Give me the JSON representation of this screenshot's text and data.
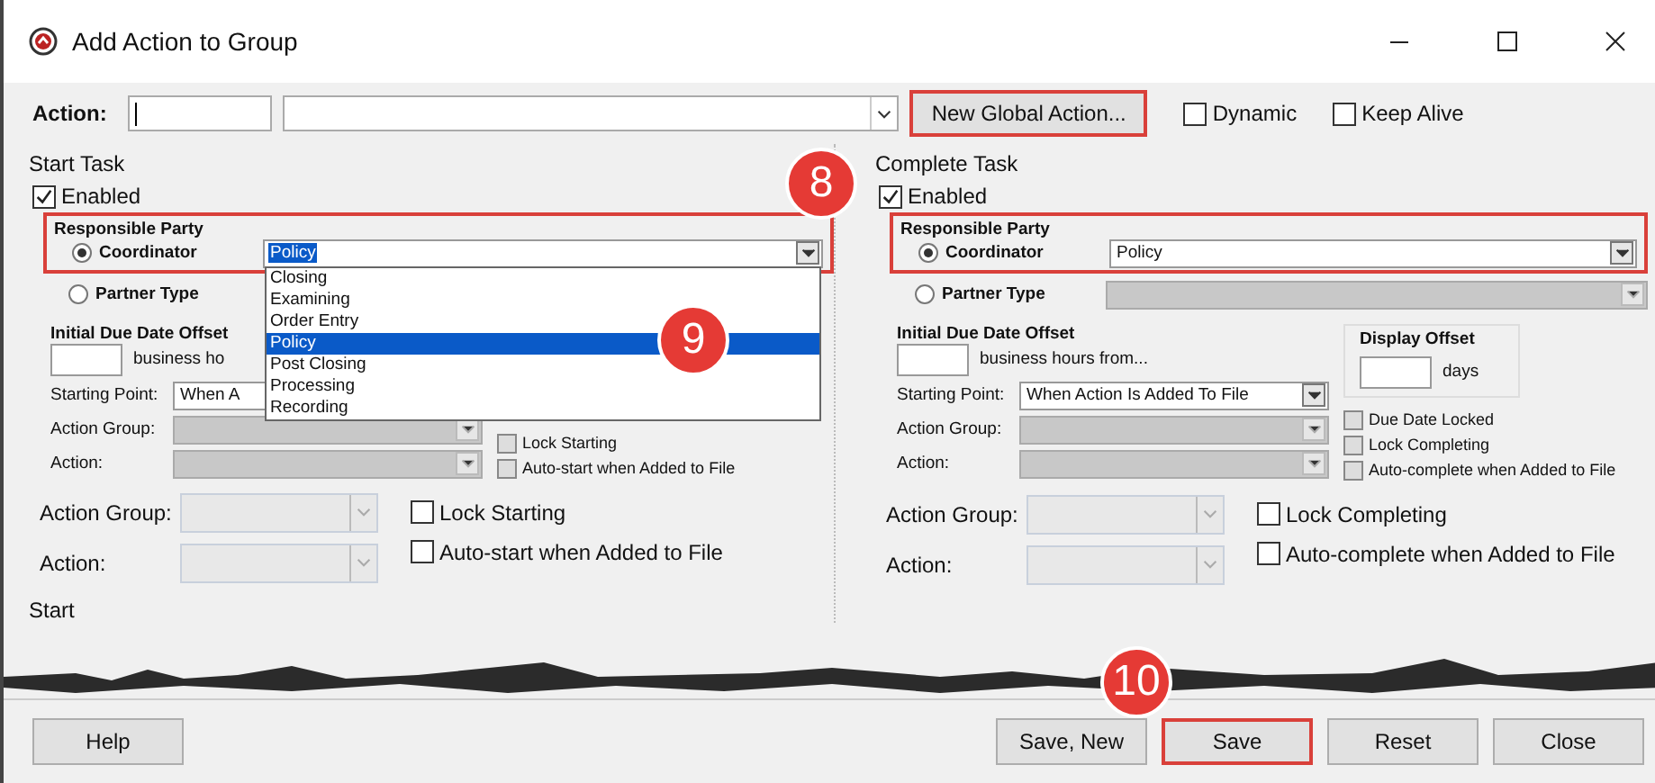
{
  "window": {
    "title": "Add Action to Group"
  },
  "action_row": {
    "label": "Action:",
    "new_global_button": {
      "label": "New Global Action...",
      "highlighted": true
    },
    "checkboxes": [
      {
        "label": "Dynamic",
        "checked": false
      },
      {
        "label": "Keep Alive",
        "checked": false
      }
    ]
  },
  "panels": [
    {
      "title": "Start Task",
      "enabled": {
        "label": "Enabled",
        "checked": true
      },
      "responsible_party": {
        "title": "Responsible Party",
        "highlighted": true,
        "coordinator": {
          "label": "Coordinator",
          "selected": true,
          "value": "Policy",
          "value_selected": true
        },
        "partner": {
          "label": "Partner Type",
          "selected": false
        },
        "dropdown": {
          "callout": "9",
          "options": [
            {
              "label": "Closing",
              "selected": false
            },
            {
              "label": "Examining",
              "selected": false
            },
            {
              "label": "Order Entry",
              "selected": false
            },
            {
              "label": "Policy",
              "selected": true
            },
            {
              "label": "Post Closing",
              "selected": false
            },
            {
              "label": "Processing",
              "selected": false
            },
            {
              "label": "Recording",
              "selected": false
            }
          ]
        }
      },
      "due_offset": {
        "title": "Initial Due Date Offset",
        "unit": "business ho"
      },
      "starting_point": {
        "label": "Starting Point:",
        "value": "When A"
      },
      "inner_fields": [
        {
          "label": "Action Group:",
          "disabled": true
        },
        {
          "label": "Action:",
          "disabled": true
        }
      ],
      "inner_checkboxes": [
        {
          "label": "Lock Starting",
          "checked": false
        },
        {
          "label": "Auto-start when Added to File",
          "checked": false
        }
      ],
      "outer_fields": [
        {
          "label": "Action Group:",
          "disabled": true
        },
        {
          "label": "Action:",
          "disabled": true
        }
      ],
      "outer_checkboxes": [
        {
          "label": "Lock Starting",
          "checked": false
        },
        {
          "label": "Auto-start when Added to File",
          "checked": false
        }
      ],
      "footer_label": "Start"
    },
    {
      "title": "Complete Task",
      "callout": "8",
      "enabled": {
        "label": "Enabled",
        "checked": true
      },
      "responsible_party": {
        "title": "Responsible Party",
        "highlighted": true,
        "coordinator": {
          "label": "Coordinator",
          "selected": true,
          "value": "Policy",
          "value_selected": false
        },
        "partner": {
          "label": "Partner Type",
          "selected": false,
          "disabled": true
        }
      },
      "due_offset": {
        "title": "Initial Due Date Offset",
        "unit": "business hours from..."
      },
      "display_offset": {
        "title": "Display Offset",
        "unit": "days"
      },
      "starting_point": {
        "label": "Starting Point:",
        "value": "When Action Is Added To File"
      },
      "inner_fields": [
        {
          "label": "Action Group:",
          "disabled": true
        },
        {
          "label": "Action:",
          "disabled": true
        }
      ],
      "inner_checkboxes": [
        {
          "label": "Due Date Locked",
          "checked": false
        },
        {
          "label": "Lock Completing",
          "checked": false
        },
        {
          "label": "Auto-complete when Added to File",
          "checked": false
        }
      ],
      "outer_fields": [
        {
          "label": "Action Group:",
          "disabled": true
        },
        {
          "label": "Action:",
          "disabled": true
        }
      ],
      "outer_checkboxes": [
        {
          "label": "Lock Completing",
          "checked": false
        },
        {
          "label": "Auto-complete when Added to File",
          "checked": false
        }
      ]
    }
  ],
  "footer_buttons": [
    {
      "label": "Help",
      "highlighted": false
    },
    {
      "label": "Save, New",
      "highlighted": false
    },
    {
      "label": "Save",
      "highlighted": true,
      "callout": "10"
    },
    {
      "label": "Reset",
      "highlighted": false
    },
    {
      "label": "Close",
      "highlighted": false
    }
  ]
}
